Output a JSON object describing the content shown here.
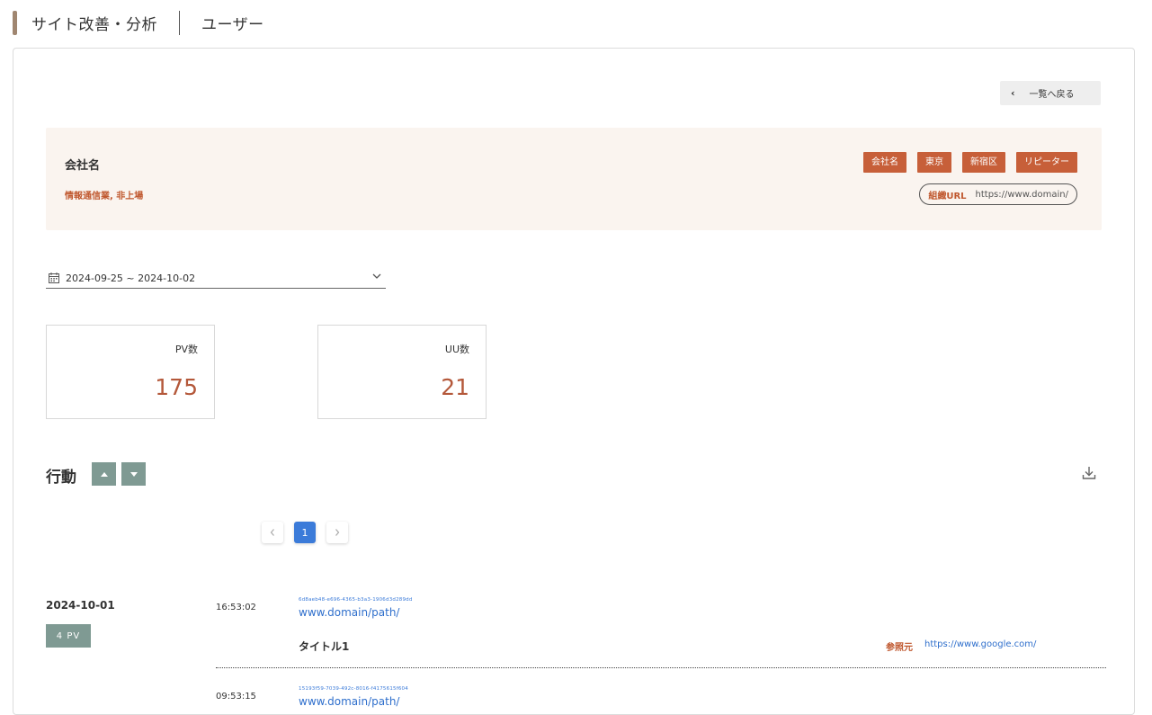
{
  "header": {
    "title": "サイト改善・分析",
    "subtitle": "ユーザー"
  },
  "back_button": {
    "label": "一覧へ戻る"
  },
  "company": {
    "name": "会社名",
    "industry": "情報通信業, 非上場",
    "tags": [
      "会社名",
      "東京",
      "新宿区",
      "リピーター"
    ],
    "org_url_label": "組織URL",
    "org_url": "https://www.domain/"
  },
  "date_range": {
    "value": "2024-09-25 ~ 2024-10-02"
  },
  "stats": {
    "pv": {
      "label": "PV数",
      "value": "175"
    },
    "uu": {
      "label": "UU数",
      "value": "21"
    }
  },
  "activity": {
    "title": "行動"
  },
  "pagination": {
    "current": "1"
  },
  "days": [
    {
      "date": "2024-10-01",
      "pv_badge": "4 PV",
      "events": [
        {
          "time": "16:53:02",
          "uuid": "6d8aeb48-e696-4365-b3a3-1906d3d289dd",
          "url": "www.domain/path/",
          "title": "タイトル1",
          "referrer_label": "参照元",
          "referrer": "https://www.google.com/"
        },
        {
          "time": "09:53:15",
          "uuid": "15193f59-7039-492c-8016-f4175615f604",
          "url": "www.domain/path/"
        }
      ]
    }
  ],
  "colors": {
    "accent": "#c75f39",
    "brand_bar": "#a08670",
    "sort_button": "#7f9a93",
    "page_active": "#3b7bd9"
  }
}
